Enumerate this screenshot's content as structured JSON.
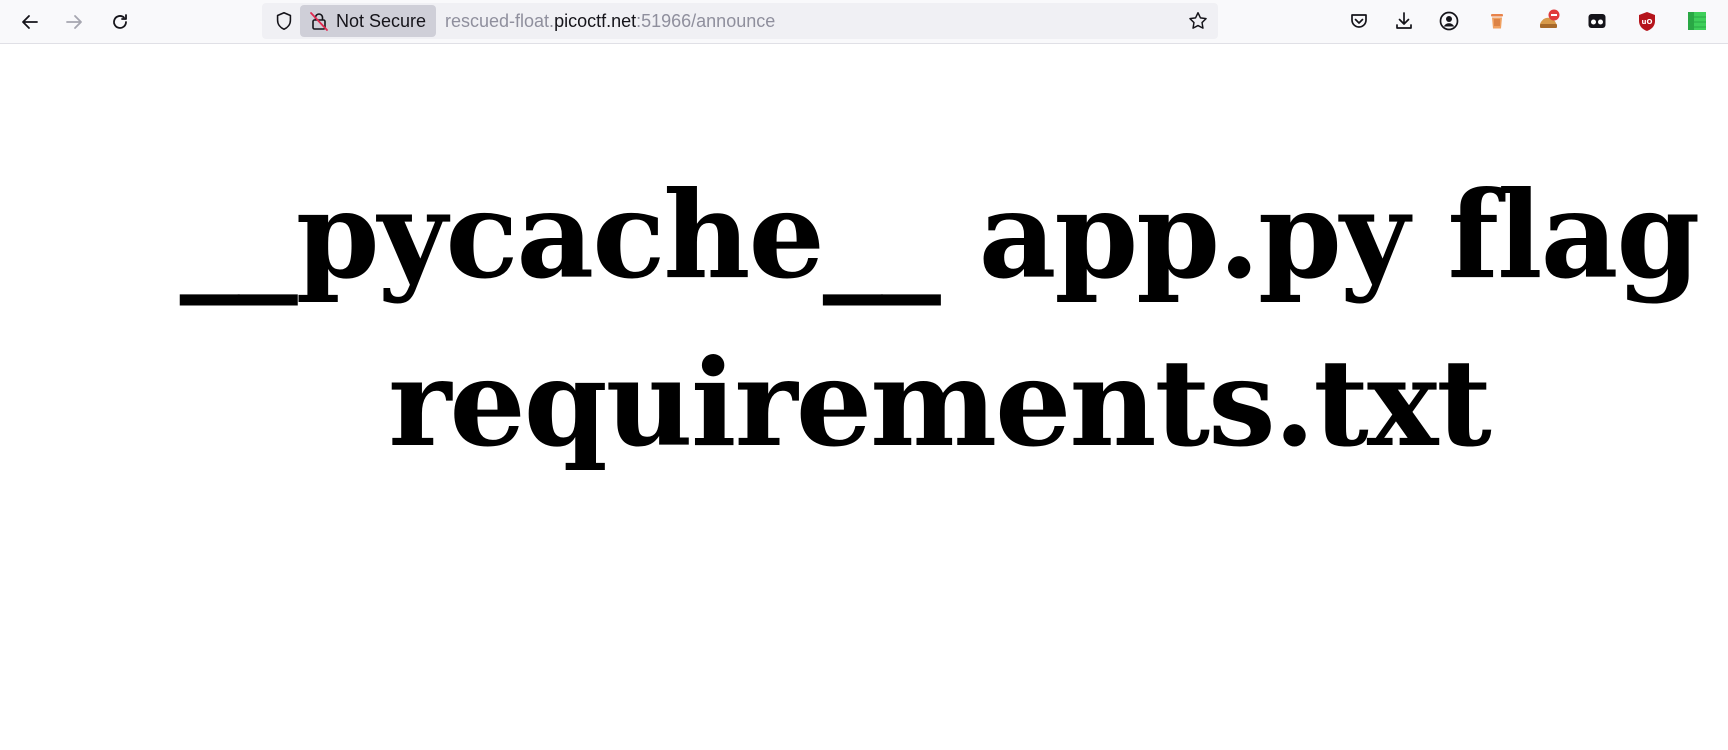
{
  "browser": {
    "nav": {
      "back": "back-icon",
      "forward": "forward-icon",
      "reload": "reload-icon"
    },
    "urlbar": {
      "security_label": "Not Secure",
      "url_prefix": "rescued-float.",
      "url_host": "picoctf.net",
      "url_suffix": ":51966/announce"
    },
    "extensions": [
      "pocket-icon",
      "downloads-icon",
      "account-icon",
      "trash-icon",
      "badge-icon",
      "mask-icon",
      "ublock-icon",
      "green-square-icon"
    ]
  },
  "page": {
    "heading": "__pycache__ app.py flag requirements.txt"
  },
  "colors": {
    "toolbar_bg": "#f9f9fb",
    "urlbar_bg": "#f0f0f4",
    "chip_bg": "#cfcfd8",
    "ublock_red": "#b5141b",
    "green": "#3fcf5a"
  }
}
